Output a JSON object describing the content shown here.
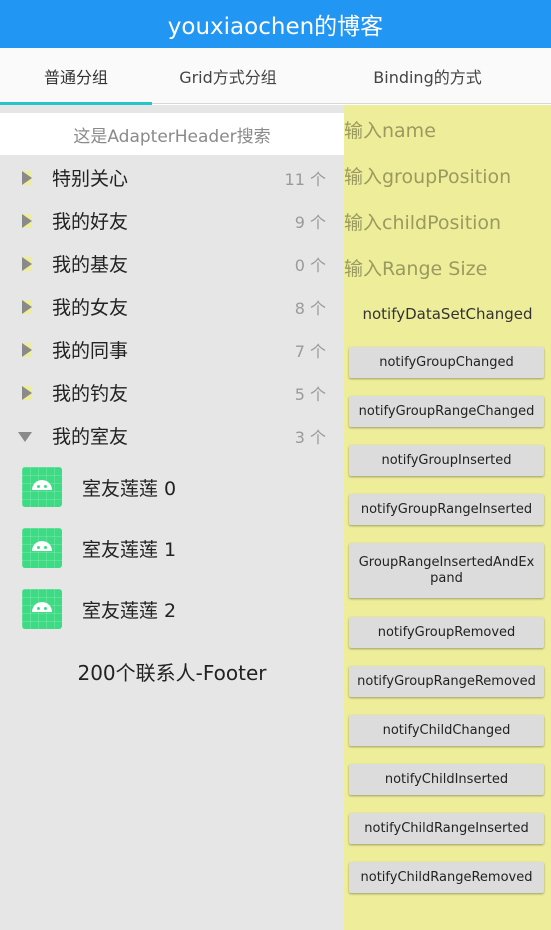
{
  "app": {
    "title": "youxiaochen的博客"
  },
  "tabs": [
    {
      "label": "普通分组",
      "selected": true
    },
    {
      "label": "Grid方式分组",
      "selected": false
    },
    {
      "label": "Binding的方式",
      "selected": false
    }
  ],
  "search": {
    "placeholder": "这是AdapterHeader搜索"
  },
  "groups": [
    {
      "name": "特别关心",
      "count": "11 个",
      "expanded": false
    },
    {
      "name": "我的好友",
      "count": "9 个",
      "expanded": false
    },
    {
      "name": "我的基友",
      "count": "0 个",
      "expanded": false
    },
    {
      "name": "我的女友",
      "count": "8 个",
      "expanded": false
    },
    {
      "name": "我的同事",
      "count": "7 个",
      "expanded": false
    },
    {
      "name": "我的钓友",
      "count": "5 个",
      "expanded": false
    },
    {
      "name": "我的室友",
      "count": "3 个",
      "expanded": true
    }
  ],
  "children": [
    {
      "name": "室友莲莲 0",
      "icon": "android-icon"
    },
    {
      "name": "室友莲莲 1",
      "icon": "android-icon"
    },
    {
      "name": "室友莲莲 2",
      "icon": "android-icon"
    }
  ],
  "footer": {
    "label": "200个联系人-Footer"
  },
  "controls": {
    "inputs": [
      {
        "placeholder": "输入name"
      },
      {
        "placeholder": "输入groupPosition"
      },
      {
        "placeholder": "输入childPosition"
      },
      {
        "placeholder": "输入Range Size"
      }
    ],
    "notify_data_set_changed": "notifyDataSetChanged",
    "buttons": [
      "notifyGroupChanged",
      "notifyGroupRangeChanged",
      "notifyGroupInserted",
      "notifyGroupRangeInserted",
      "GroupRangeInsertedAndExpand",
      "notifyGroupRemoved",
      "notifyGroupRangeRemoved",
      "notifyChildChanged",
      "notifyChildInserted",
      "notifyChildRangeInserted",
      "notifyChildRangeRemoved"
    ]
  },
  "colors": {
    "appbar": "#2196f3",
    "tab_indicator": "#26c6c6",
    "left_bg": "#e6e6e6",
    "right_bg": "#eeee9a",
    "android_green": "#3ddc84"
  }
}
